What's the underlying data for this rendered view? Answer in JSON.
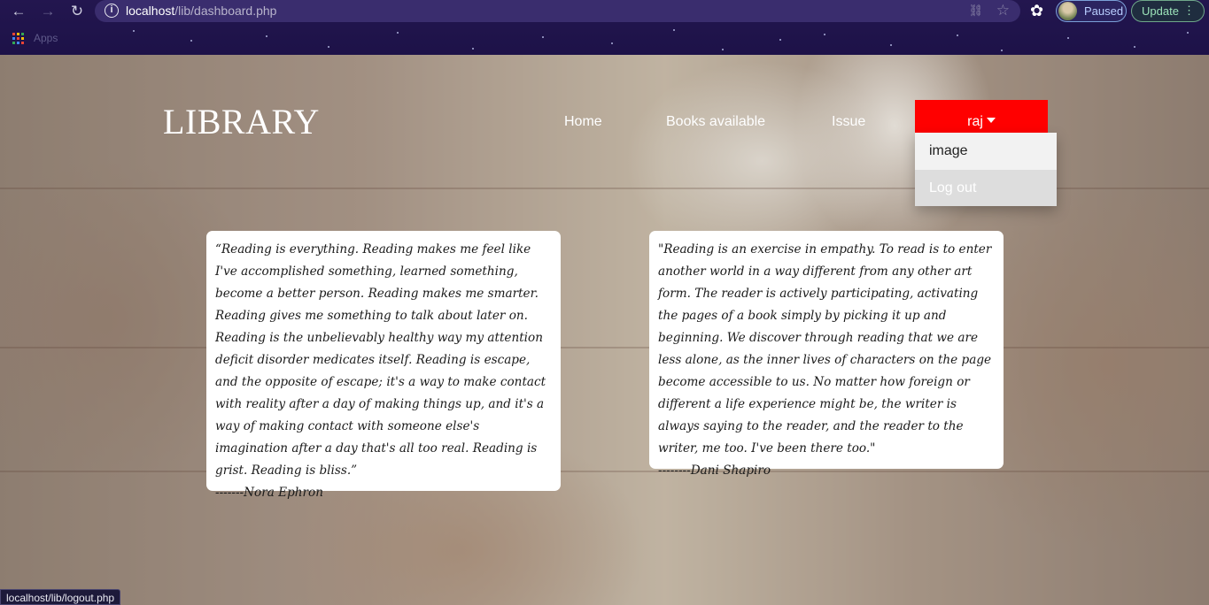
{
  "browser": {
    "url_host": "localhost",
    "url_path": "/lib/dashboard.php",
    "profile_status": "Paused",
    "update_label": "Update",
    "bookmarks_apps": "Apps",
    "status_bar_url": "localhost/lib/logout.php"
  },
  "header": {
    "logo": "LIBRARY",
    "nav": [
      "Home",
      "Books available",
      "Issue"
    ],
    "user": "raj"
  },
  "dropdown": {
    "items": [
      "image",
      "Log out"
    ]
  },
  "quotes": [
    {
      "text": "“Reading is everything. Reading makes me feel like I've accomplished something, learned something, become a better person. Reading makes me smarter. Reading gives me something to talk about later on. Reading is the unbelievably healthy way my attention deficit disorder medicates itself. Reading is escape, and the opposite of escape; it's a way to make contact with reality after a day of making things up, and it's a way of making contact with someone else's imagination after a day that's all too real. Reading is grist. Reading is bliss.”",
      "author": "-------Nora Ephron"
    },
    {
      "text": "\"Reading is an exercise in empathy. To read is to enter another world in a way different from any other art form. The reader is actively participating, activating the pages of a book simply by picking it up and beginning. We discover through reading that we are less alone, as the inner lives of characters on the page become accessible to us. No matter how foreign or different a life experience might be, the writer is always saying to the reader, and the reader to the writer, me too. I've been there too.\"",
      "author": "--------Dani Shapiro"
    }
  ],
  "colors": {
    "accent": "#ff0000",
    "chrome": "#23164f"
  }
}
